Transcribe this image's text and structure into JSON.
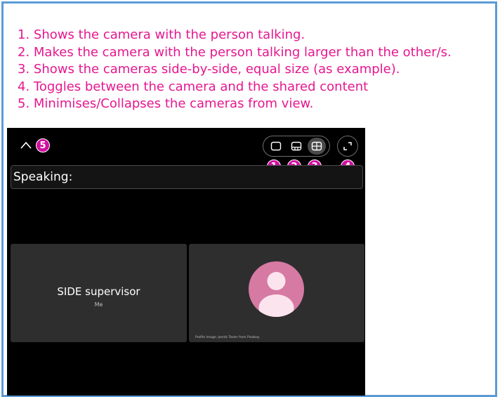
{
  "instructions": [
    "1. Shows the camera with the person talking.",
    "2. Makes the camera with the person talking larger than the other/s.",
    "3. Shows the cameras side-by-side, equal size (as example).",
    "4. Toggles between the camera and the shared content",
    "5. Minimises/Collapses the cameras from view."
  ],
  "toolbar": {
    "collapse_icon": "chevron-up-icon",
    "layout_icons": [
      "speaker-view-icon",
      "large-speaker-view-icon",
      "grid-view-icon"
    ],
    "active_layout": "grid-view",
    "toggle_icon": "expand-icon",
    "badges": [
      "5",
      "1",
      "2",
      "3",
      "4"
    ]
  },
  "speaking_label": "Speaking:",
  "participants": [
    {
      "name": "SIDE supervisor",
      "subtitle": "Me"
    },
    {
      "avatar_icon": "person-avatar-icon",
      "credit": "Profile image: Jannik Texler from Pixabay"
    }
  ],
  "colors": {
    "annotation": "#e5178f",
    "badge": "#d10fa0",
    "frame_border": "#5b9bd5",
    "avatar": "#d67aa3",
    "tile": "#2e2e2e"
  }
}
